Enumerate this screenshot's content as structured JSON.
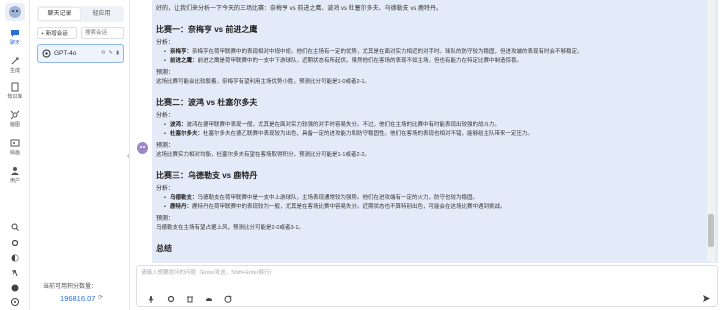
{
  "rail": {
    "items": [
      {
        "label": "聊天",
        "icon": "chat-icon"
      },
      {
        "label": "生成",
        "icon": "generate-icon"
      },
      {
        "label": "知识库",
        "icon": "knowledge-icon"
      },
      {
        "label": "脑图",
        "icon": "mindmap-icon"
      },
      {
        "label": "绘画",
        "icon": "paint-icon"
      },
      {
        "label": "用户",
        "icon": "user-icon"
      }
    ]
  },
  "panel": {
    "tab_history": "聊天记录",
    "tab_apps": "轻应用",
    "new_chat": "+ 新增会话",
    "search_placeholder": "搜索会话",
    "session_title": "GPT-4o",
    "credits_label": "当前可用积分数量：",
    "credits_value": "196816.07"
  },
  "message": {
    "intro": "好的，让我们来分析一下今天的三场比赛：奈梅亨 vs 前进之鹰、波鸿 vs 杜塞尔多夫、乌德勒支 vs 鹿特丹。",
    "matches": [
      {
        "title": "比赛一：奈梅亨 vs 前进之鹰",
        "analysis_label": "分析：",
        "bullets": [
          {
            "team": "奈梅亨：",
            "text": "奈梅亨在荷甲联赛中的表现相对中规中矩。他们在主场有一定的优势，尤其是在面对实力相近的对手时。球队的防守较为稳固，但进攻端的表现有时会不够稳定。"
          },
          {
            "team": "前进之鹰：",
            "text": "前进之鹰是荷甲联赛中的一支中下游球队，近期状态有所起伏。虽然他们在客场的表现不如主场，但也有能力在特定比赛中制造惊喜。"
          }
        ],
        "prediction_label": "预测：",
        "prediction": "这场比赛可能会比较胶着，奈梅亨有望利用主场优势小胜，预测比分可能是1-0或者2-1。"
      },
      {
        "title": "比赛二：波鸿 vs 杜塞尔多夫",
        "analysis_label": "分析：",
        "bullets": [
          {
            "team": "波鸿：",
            "text": "波鸿在德甲联赛中表现一般，尤其是在面对实力较强的对手时容易失分。不过，他们在主场的比赛中有时能表现出较强的战斗力。"
          },
          {
            "team": "杜塞尔多夫：",
            "text": "杜塞尔多夫在德乙联赛中表现较为出色，具备一定的进攻能力和防守稳固性。他们在客场的表现也相对不错，能够给主队带来一定压力。"
          }
        ],
        "prediction_label": "预测：",
        "prediction": "这场比赛实力相对均衡，杜塞尔多夫有望在客场取得积分，预测比分可能是1-1或者2-2。"
      },
      {
        "title": "比赛三：乌德勒支 vs 鹿特丹",
        "analysis_label": "分析：",
        "bullets": [
          {
            "team": "乌德勒支：",
            "text": "乌德勒支在荷甲联赛中是一支中上游球队，主场表现通常较为强势。他们在进攻端有一定的火力，防守也较为稳固。"
          },
          {
            "team": "鹿特丹：",
            "text": "鹿特丹在荷甲联赛中的表现较为一般，尤其是在客场比赛中容易失分。近期状态也不算特别出色，可能会在这场比赛中遇到挑战。"
          }
        ],
        "prediction_label": "预测：",
        "prediction": "乌德勒支在主场有望占据上风，预测比分可能是2-0或者3-1。"
      }
    ],
    "summary_title": "总结"
  },
  "input": {
    "placeholder": "请输入想要提问的问题（Enter发送，Shift+Enter换行）"
  },
  "colors": {
    "accent": "#2d6fd6",
    "message_bg": "#e4ebf8",
    "session_bg": "#eef4fd"
  }
}
